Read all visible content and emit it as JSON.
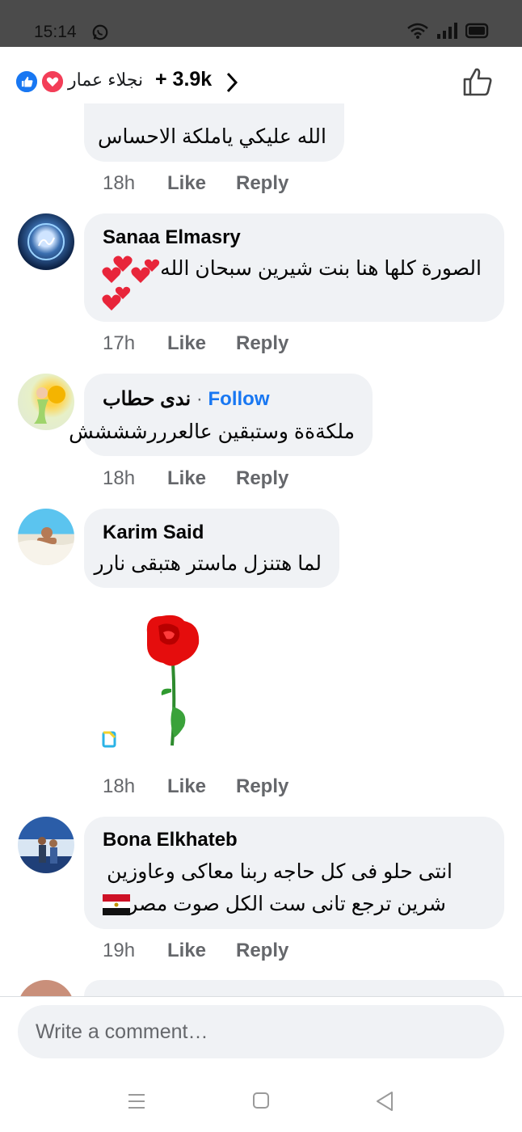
{
  "status_bar": {
    "time": "15:14"
  },
  "reactions": {
    "names": "نجلاء عمار",
    "count": "+ 3.9k"
  },
  "comments": [
    {
      "author": "",
      "text": "الله عليكي ياملكة الاحساس",
      "time": "18h"
    },
    {
      "author": "Sanaa Elmasry",
      "text": "الصورة كلها هنا بنت شيرين سبحان الله",
      "time": "17h"
    },
    {
      "author": "ندى حطاب",
      "follow": "Follow",
      "text": "ملكةةة وستبقين عالعرررشششش",
      "time": "18h"
    },
    {
      "author": "Karim Said",
      "text": "لما هتنزل ماستر هتبقى نارر",
      "time": "18h"
    },
    {
      "author": "Bona Elkhateb",
      "text_line1": "انتى حلو فى كل حاجه ربنا معاكى وعاوزين",
      "text_line2": "شرين ترجع تانى ست الكل صوت مصر",
      "time": "19h"
    }
  ],
  "actions": {
    "like": "Like",
    "reply": "Reply"
  },
  "composer": {
    "placeholder": "Write a comment…"
  },
  "colors": {
    "like_blue": "#1877f2",
    "love_red": "#f33e58",
    "bubble": "#f0f2f5",
    "meta_gray": "#65676b"
  }
}
